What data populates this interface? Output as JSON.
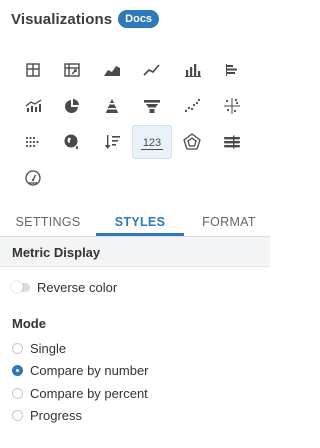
{
  "header": {
    "title": "Visualizations",
    "docs_label": "Docs"
  },
  "visualizations": [
    {
      "icon": "table-icon"
    },
    {
      "icon": "pivot-table-icon"
    },
    {
      "icon": "area-chart-icon"
    },
    {
      "icon": "line-chart-icon"
    },
    {
      "icon": "bar-chart-icon"
    },
    {
      "icon": "horizontal-bar-chart-icon"
    },
    {
      "icon": "combo-chart-icon"
    },
    {
      "icon": "pie-chart-icon"
    },
    {
      "icon": "pyramid-chart-icon"
    },
    {
      "icon": "funnel-chart-icon"
    },
    {
      "icon": "scatter-plot-icon"
    },
    {
      "icon": "quadrant-chart-icon"
    },
    {
      "icon": "dot-matrix-icon"
    },
    {
      "icon": "map-icon"
    },
    {
      "icon": "sort-list-icon"
    },
    {
      "icon": "metric-display-icon",
      "label": "123",
      "selected": true
    },
    {
      "icon": "radar-chart-icon"
    },
    {
      "icon": "bullet-chart-icon"
    },
    {
      "icon": "gauge-icon"
    }
  ],
  "tabs": [
    {
      "label": "SETTINGS",
      "active": false
    },
    {
      "label": "STYLES",
      "active": true
    },
    {
      "label": "FORMAT",
      "active": false
    }
  ],
  "section": {
    "title": "Metric Display"
  },
  "reverse_color": {
    "label": "Reverse color",
    "enabled": false
  },
  "mode": {
    "label": "Mode",
    "options": [
      {
        "label": "Single",
        "selected": false
      },
      {
        "label": "Compare by number",
        "selected": true
      },
      {
        "label": "Compare by percent",
        "selected": false
      },
      {
        "label": "Progress",
        "selected": false
      }
    ]
  },
  "colors": {
    "accent": "#2d79b9",
    "icon": "#4a4a4a"
  }
}
